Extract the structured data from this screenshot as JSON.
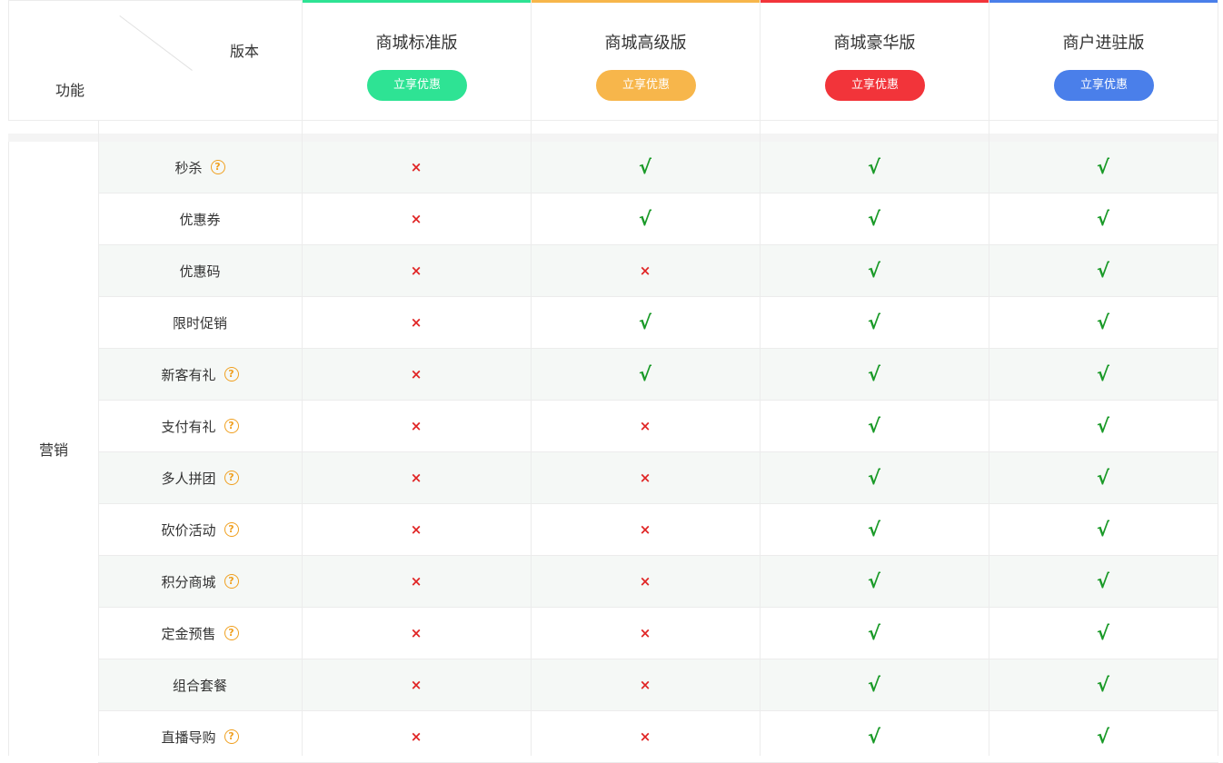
{
  "header": {
    "corner_version_label": "版本",
    "corner_function_label": "功能",
    "plans": [
      {
        "name": "商城标准版",
        "button": "立享优惠",
        "color": "#2ee394"
      },
      {
        "name": "商城高级版",
        "button": "立享优惠",
        "color": "#f7b64b"
      },
      {
        "name": "商城豪华版",
        "button": "立享优惠",
        "color": "#f2343a"
      },
      {
        "name": "商户进驻版",
        "button": "立享优惠",
        "color": "#4a7fea"
      }
    ]
  },
  "category": "营销",
  "yes_symbol": "√",
  "no_symbol": "×",
  "help_symbol": "?",
  "features": [
    {
      "name": "秒杀",
      "help": true,
      "support": [
        false,
        true,
        true,
        true
      ]
    },
    {
      "name": "优惠券",
      "help": false,
      "support": [
        false,
        true,
        true,
        true
      ]
    },
    {
      "name": "优惠码",
      "help": false,
      "support": [
        false,
        false,
        true,
        true
      ]
    },
    {
      "name": "限时促销",
      "help": false,
      "support": [
        false,
        true,
        true,
        true
      ]
    },
    {
      "name": "新客有礼",
      "help": true,
      "support": [
        false,
        true,
        true,
        true
      ]
    },
    {
      "name": "支付有礼",
      "help": true,
      "support": [
        false,
        false,
        true,
        true
      ]
    },
    {
      "name": "多人拼团",
      "help": true,
      "support": [
        false,
        false,
        true,
        true
      ]
    },
    {
      "name": "砍价活动",
      "help": true,
      "support": [
        false,
        false,
        true,
        true
      ]
    },
    {
      "name": "积分商城",
      "help": true,
      "support": [
        false,
        false,
        true,
        true
      ]
    },
    {
      "name": "定金预售",
      "help": true,
      "support": [
        false,
        false,
        true,
        true
      ]
    },
    {
      "name": "组合套餐",
      "help": false,
      "support": [
        false,
        false,
        true,
        true
      ]
    },
    {
      "name": "直播导购",
      "help": true,
      "support": [
        false,
        false,
        true,
        true
      ]
    }
  ]
}
